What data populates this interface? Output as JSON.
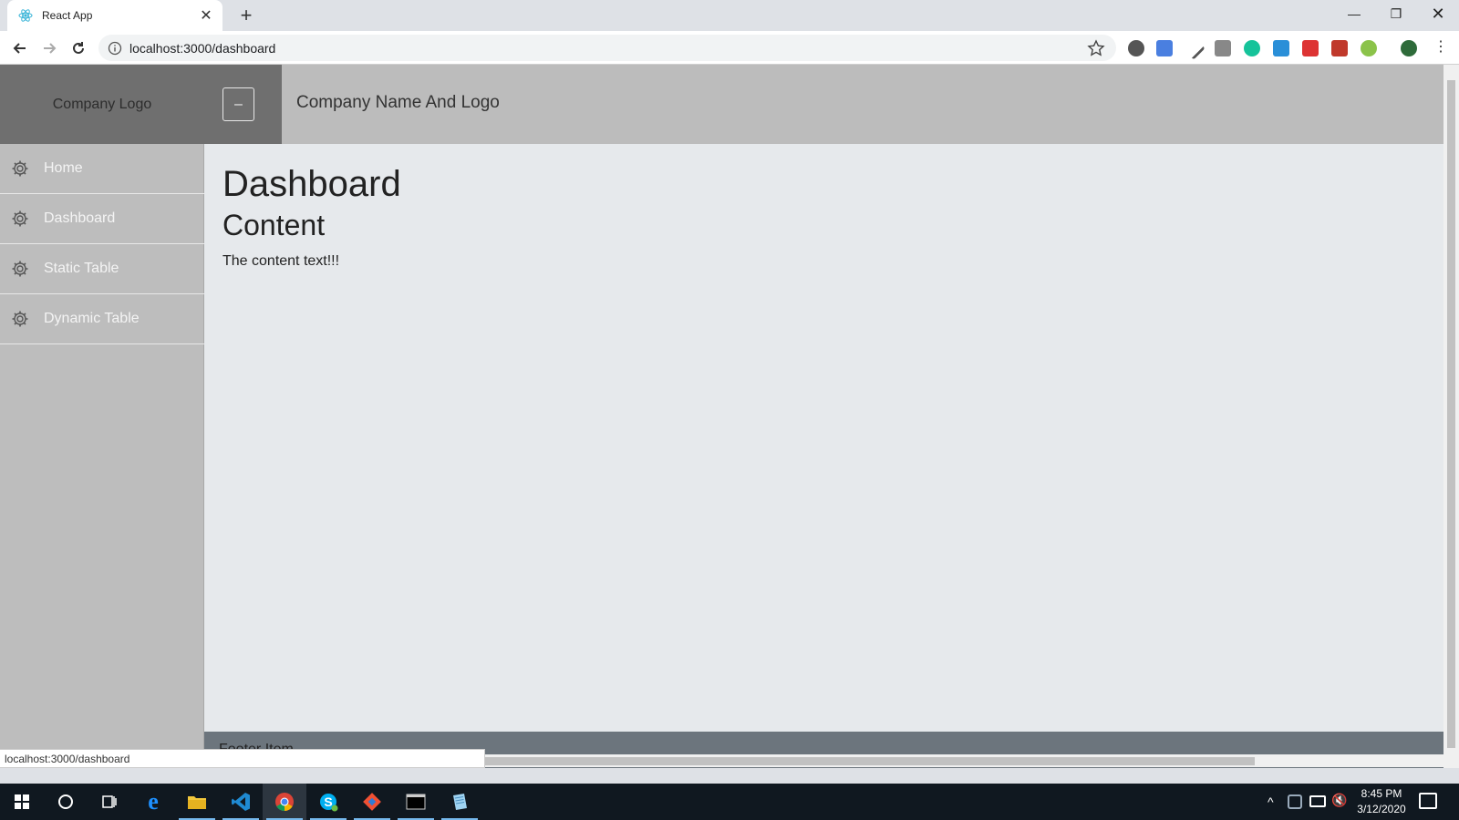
{
  "browser": {
    "tab_title": "React App",
    "url": "localhost:3000/dashboard",
    "status_url": "localhost:3000/dashboard"
  },
  "app": {
    "logo_text": "Company Logo",
    "toggle_symbol": "–",
    "company_name": "Company Name And Logo",
    "nav": [
      {
        "label": "Home"
      },
      {
        "label": "Dashboard"
      },
      {
        "label": "Static Table"
      },
      {
        "label": "Dynamic Table"
      }
    ],
    "page_title": "Dashboard",
    "section_title": "Content",
    "content_text": "The content text!!!",
    "footer_text": "Footer Item"
  },
  "taskbar": {
    "time": "8:45 PM",
    "date": "3/12/2020"
  },
  "colors": {
    "sidebar": "#bdbdbd",
    "topbar": "#bcbcbc",
    "logo_bg": "#6f6f6f",
    "main_bg": "#e6e9ec",
    "footer": "#6c757d"
  }
}
